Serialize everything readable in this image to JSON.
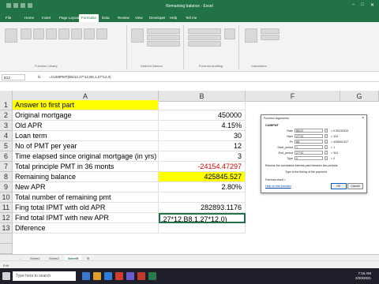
{
  "app": {
    "window_title": "Remaining balance - Excel",
    "tabs": [
      "File",
      "Home",
      "Insert",
      "Page Layout",
      "Formulas",
      "Data",
      "Review",
      "View",
      "Developer",
      "Help",
      "Tell me"
    ],
    "active_tab": "Formulas",
    "ribbon_groups": [
      "Function Library",
      "Defined Names",
      "Formula Auditing",
      "Calculation"
    ]
  },
  "formula_bar": {
    "name_box": "B12",
    "fx": "fx",
    "formula": "=CUMIPMT(B6/12,27*12,B8,1,27*12,0)"
  },
  "sheet": {
    "col_headers": [
      "A",
      "B",
      "F",
      "G"
    ],
    "rows": [
      {
        "n": "1",
        "label": "Answer to first part",
        "value": ""
      },
      {
        "n": "2",
        "label": "Original mortgage",
        "value": "450000"
      },
      {
        "n": "3",
        "label": "Old APR",
        "value": "4.15%"
      },
      {
        "n": "4",
        "label": "Loan term",
        "value": "30"
      },
      {
        "n": "5",
        "label": "No of PMT per year",
        "value": "12"
      },
      {
        "n": "6",
        "label": "Time elapsed since original mortgage (in yrs)",
        "value": "3"
      },
      {
        "n": "7",
        "label": "Total principle PMT in 36 monts",
        "value": "-24154.47297"
      },
      {
        "n": "8",
        "label": "Remaining balance",
        "value": "425845.527"
      },
      {
        "n": "9",
        "label": "New APR",
        "value": "2.80%"
      },
      {
        "n": "10",
        "label": "Total number of remaining pmt",
        "value": ""
      },
      {
        "n": "11",
        "label": "Fing total IPMT with old APR",
        "value": "282893.1176"
      },
      {
        "n": "12",
        "label": "Find total IPMT with new APR",
        "value": ",27*12,B8,1,27*12,0)"
      },
      {
        "n": "13",
        "label": "Diference",
        "value": ""
      }
    ]
  },
  "sheet_tabs": [
    "...",
    "Sheet1",
    "Sheet2",
    "Sheet5"
  ],
  "active_sheet": "Sheet5",
  "status": "Edit",
  "dialog": {
    "title": "Function Arguments",
    "close": "×",
    "function": "CUMIPMT",
    "args": [
      {
        "label": "Rate",
        "value": "B6/12",
        "result": "= 0.00233333"
      },
      {
        "label": "Nper",
        "value": "27*12",
        "result": "= 324"
      },
      {
        "label": "Pv",
        "value": "B8",
        "result": "= 425845.527"
      },
      {
        "label": "Start_period",
        "value": "1",
        "result": "= 1"
      },
      {
        "label": "End_period",
        "value": "27*12",
        "result": "= 324"
      },
      {
        "label": "Type",
        "value": "0",
        "result": "= 0"
      }
    ],
    "description": "Returns the cumulative interest paid between two periods.",
    "type_help": "Type   is the timing of the payment.",
    "formula_result": "Formula result =",
    "help_link": "Help on this function",
    "ok": "OK",
    "cancel": "Cancel"
  },
  "taskbar": {
    "search": "Type here to search",
    "time": "7:16 AM",
    "date": "2/20/2021"
  },
  "colors": {
    "excel_green": "#217346",
    "highlight": "#ffff00",
    "negative": "#e00000"
  }
}
